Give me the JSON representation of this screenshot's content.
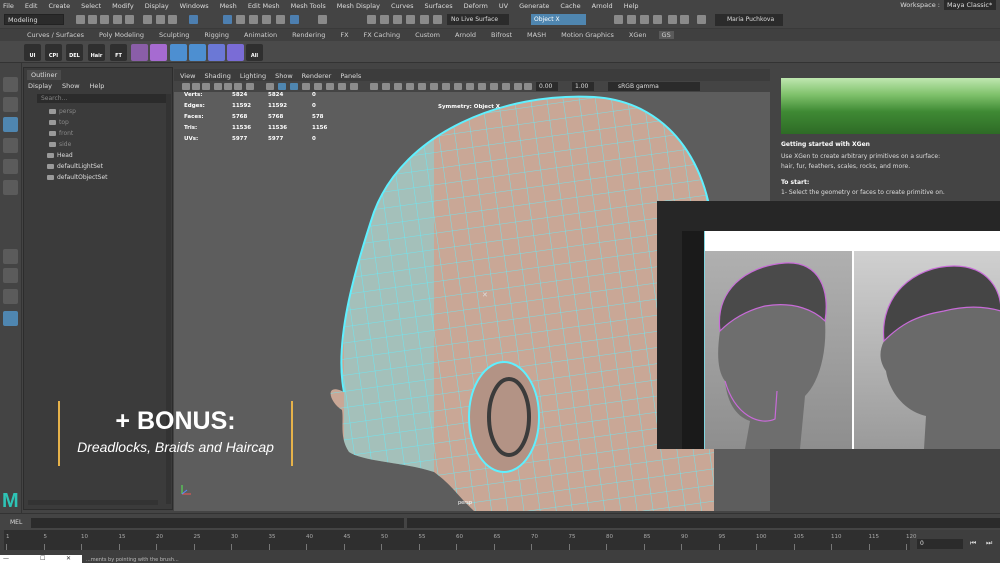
{
  "menubar": {
    "items": [
      "File",
      "Edit",
      "Create",
      "Select",
      "Modify",
      "Display",
      "Windows",
      "Mesh",
      "Edit Mesh",
      "Mesh Tools",
      "Mesh Display",
      "Curves",
      "Surfaces",
      "Deform",
      "UV",
      "Generate",
      "Cache",
      "Arnold",
      "Help"
    ],
    "workspace_label": "Workspace :",
    "workspace_value": "Maya Classic*"
  },
  "statusline": {
    "mode": "Modeling",
    "live_surface": "No Live Surface",
    "symmetry_target": "Object X",
    "user": "Maria Puchkova"
  },
  "shelf": {
    "tabs": [
      "Curves / Surfaces",
      "Poly Modeling",
      "Sculpting",
      "Rigging",
      "Animation",
      "Rendering",
      "FX",
      "FX Caching",
      "Custom",
      "Arnold",
      "Bifrost",
      "MASH",
      "Motion Graphics",
      "XGen",
      "GS"
    ],
    "active_tab": "GS",
    "icons": [
      {
        "label": "UI",
        "color": "#3a3a3a"
      },
      {
        "label": "CPI",
        "color": "#3a3a3a"
      },
      {
        "label": "DEL",
        "color": "#3a3a3a"
      },
      {
        "label": "Hair",
        "color": "#3a3a3a"
      },
      {
        "label": "FT",
        "color": "#3a3a3a"
      },
      {
        "label": "All",
        "color": "#3a3a3a"
      }
    ]
  },
  "outliner": {
    "tab": "Outliner",
    "menu": [
      "Display",
      "Show",
      "Help"
    ],
    "search_placeholder": "Search...",
    "items": [
      {
        "label": "persp",
        "dim": true
      },
      {
        "label": "top",
        "dim": true
      },
      {
        "label": "front",
        "dim": true
      },
      {
        "label": "side",
        "dim": true
      },
      {
        "label": "Head",
        "dim": false
      },
      {
        "label": "defaultLightSet",
        "dim": false
      },
      {
        "label": "defaultObjectSet",
        "dim": false
      }
    ]
  },
  "viewport": {
    "menu": [
      "View",
      "Shading",
      "Lighting",
      "Show",
      "Renderer",
      "Panels"
    ],
    "near_value": "0.00",
    "far_value": "1.00",
    "color_space": "sRGB gamma",
    "hud": [
      {
        "label": "Verts:",
        "a": "5824",
        "b": "5824",
        "c": "0"
      },
      {
        "label": "Edges:",
        "a": "11592",
        "b": "11592",
        "c": "0"
      },
      {
        "label": "Faces:",
        "a": "5768",
        "b": "5768",
        "c": "578"
      },
      {
        "label": "Tris:",
        "a": "11536",
        "b": "11536",
        "c": "1156"
      },
      {
        "label": "UVs:",
        "a": "5977",
        "b": "5977",
        "c": "0"
      }
    ],
    "symmetry": "Symmetry: Object X",
    "camera": "persp",
    "mesh_color": "#5ff0ff",
    "skin_color": "#c9a796"
  },
  "rightpanel": {
    "title": "Getting started with XGen",
    "line1": "Use XGen to create arbitrary primitives on a surface:",
    "line2": "hair, fur, feathers, scales, rocks, and more.",
    "to_start": "To start:",
    "step1": "1- Select the geometry or faces to create primitive on."
  },
  "bonus": {
    "title": "+ BONUS:",
    "subtitle": "Dreadlocks, Braids and Haircap"
  },
  "logo": "M",
  "cmdline": {
    "label": "MEL"
  },
  "timeslider": {
    "ticks": [
      "1",
      "5",
      "10",
      "15",
      "20",
      "25",
      "30",
      "35",
      "40",
      "45",
      "50",
      "55",
      "60",
      "65",
      "70",
      "75",
      "80",
      "85",
      "90",
      "95",
      "100",
      "105",
      "110",
      "115",
      "120"
    ],
    "current_frame": "0"
  },
  "helpline": "...ments by pointing with the brush..."
}
